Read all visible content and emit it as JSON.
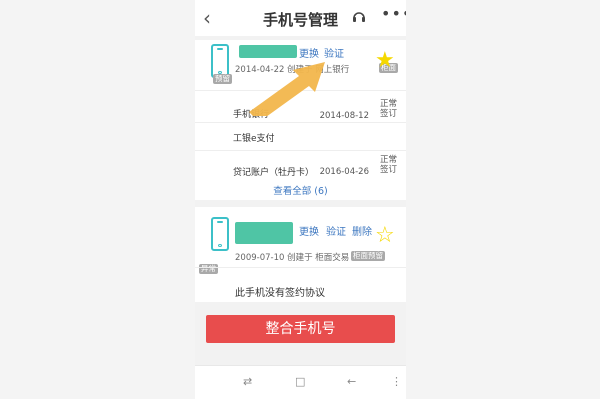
{
  "header": {
    "title": "手机号管理",
    "back_icon": "chevron-left-icon",
    "service_icon": "headset-icon",
    "more_icon": "more-icon"
  },
  "card1": {
    "replace_label": "更换",
    "verify_label": "验证",
    "created_text": "2014-04-22 创建于 网上银行",
    "tag_counter": "柜面",
    "tag_reserved": "预留",
    "starred": true,
    "rows": [
      {
        "name": "手机银行",
        "status": "正常",
        "status2": "签订",
        "date": "2014-08-12"
      },
      {
        "name": "工银e支付",
        "status": "",
        "status2": "",
        "date": ""
      },
      {
        "name": "贷记账户（牡丹卡）",
        "status": "正常",
        "status2": "签订",
        "date": "2016-04-26"
      }
    ],
    "view_all": "查看全部 (6)"
  },
  "card2": {
    "replace_label": "更换",
    "verify_label": "验证",
    "delete_label": "删除",
    "created_text": "2009-07-10 创建于 柜面交易",
    "tag_reserved": "柜面预留",
    "tag_abnormal": "异常",
    "starred": false,
    "note": "此手机没有签约协议"
  },
  "actions": {
    "merge_label": "整合手机号"
  },
  "colors": {
    "accent": "#e84d4d",
    "link": "#3d77c0",
    "icon": "#3cc0c8",
    "mask": "#4fc5a5",
    "star": "#f5d800",
    "arrow": "#f2b64c"
  }
}
